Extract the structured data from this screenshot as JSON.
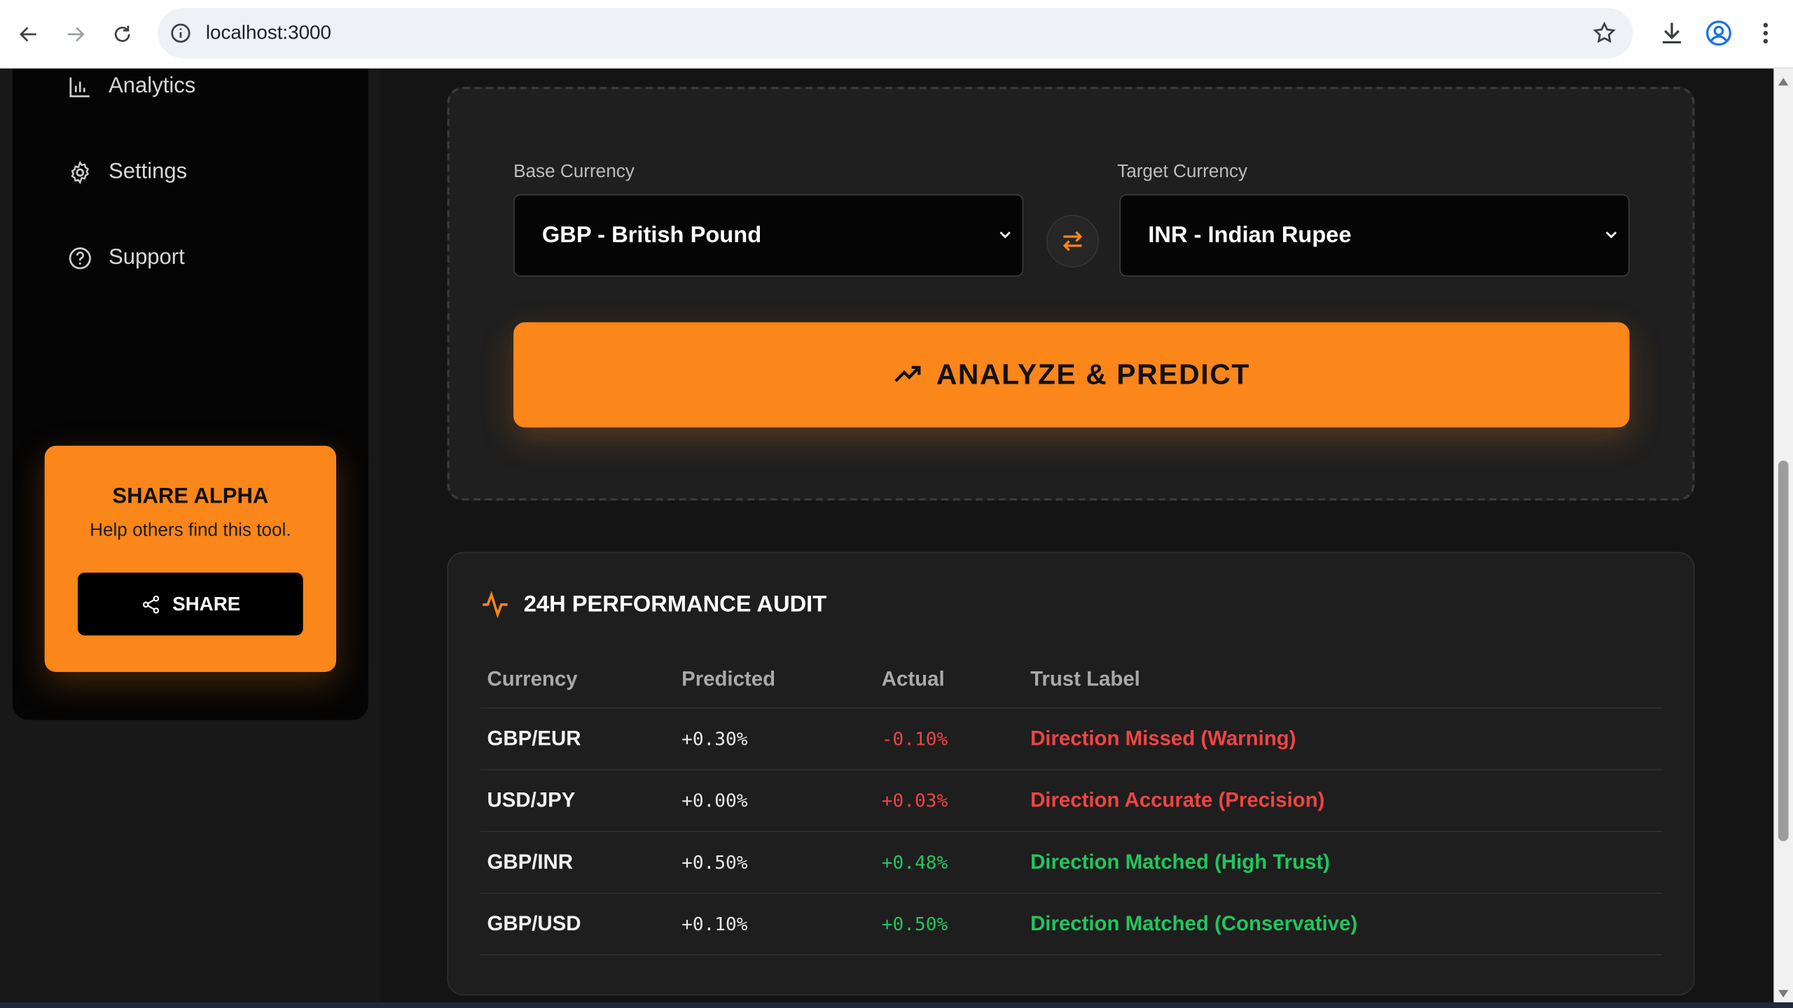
{
  "browser": {
    "url": "localhost:3000"
  },
  "sidebar": {
    "items": [
      {
        "label": "Analytics",
        "icon": "bar-chart-icon"
      },
      {
        "label": "Settings",
        "icon": "gear-icon"
      },
      {
        "label": "Support",
        "icon": "help-circle-icon"
      }
    ],
    "share_card": {
      "title": "SHARE ALPHA",
      "subtitle": "Help others find this tool.",
      "button_label": "SHARE"
    }
  },
  "converter": {
    "base_label": "Base Currency",
    "base_value": "GBP - British Pound",
    "target_label": "Target Currency",
    "target_value": "INR - Indian Rupee",
    "analyze_label": "ANALYZE & PREDICT"
  },
  "audit": {
    "title": "24H PERFORMANCE AUDIT",
    "columns": [
      "Currency",
      "Predicted",
      "Actual",
      "Trust Label"
    ],
    "rows": [
      {
        "currency": "GBP/EUR",
        "predicted": "+0.30%",
        "actual": "-0.10%",
        "trust": "Direction Missed (Warning)",
        "actual_color": "#ef4444",
        "trust_color": "#ef4444"
      },
      {
        "currency": "USD/JPY",
        "predicted": "+0.00%",
        "actual": "+0.03%",
        "trust": "Direction Accurate (Precision)",
        "actual_color": "#ef4444",
        "trust_color": "#ef4444"
      },
      {
        "currency": "GBP/INR",
        "predicted": "+0.50%",
        "actual": "+0.48%",
        "trust": "Direction Matched (High Trust)",
        "actual_color": "#22c55e",
        "trust_color": "#22c55e"
      },
      {
        "currency": "GBP/USD",
        "predicted": "+0.10%",
        "actual": "+0.50%",
        "trust": "Direction Matched (Conservative)",
        "actual_color": "#22c55e",
        "trust_color": "#22c55e"
      }
    ]
  },
  "colors": {
    "accent": "#fb861a",
    "danger": "#ef4444",
    "success": "#22c55e"
  }
}
